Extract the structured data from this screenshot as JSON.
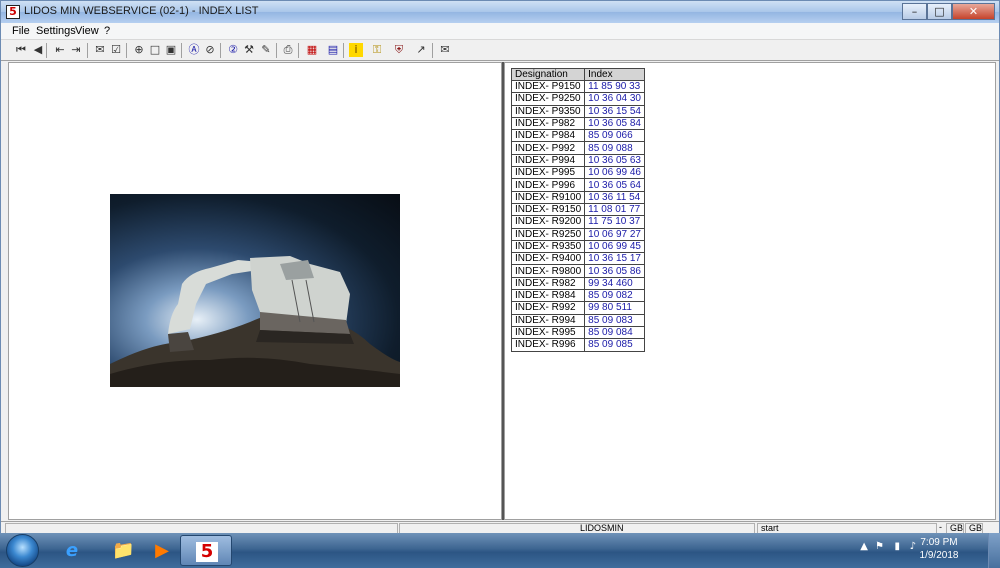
{
  "window": {
    "title": "LIDOS MIN WEBSERVICE (02-1) - INDEX LIST",
    "app_icon_text": "5",
    "minimize_glyph": "–",
    "maximize_glyph": "□",
    "close_glyph": "✕"
  },
  "menu": {
    "items": [
      "File",
      "Settings",
      "View",
      "?"
    ]
  },
  "toolbar": {
    "icons": [
      {
        "name": "first-page-icon",
        "glyph": "⏮"
      },
      {
        "name": "prev-page-icon",
        "glyph": "◀"
      },
      {
        "name": "back-icon",
        "glyph": "⇤"
      },
      {
        "name": "forward-icon",
        "glyph": "⇥"
      },
      {
        "name": "mail-icon",
        "glyph": "✉"
      },
      {
        "name": "checklist-icon",
        "glyph": "☑"
      },
      {
        "name": "zoom-icon",
        "glyph": "⊕"
      },
      {
        "name": "page-icon",
        "glyph": "□"
      },
      {
        "name": "page-fit-icon",
        "glyph": "▣"
      },
      {
        "name": "search-a-icon",
        "glyph": "Ⓐ"
      },
      {
        "name": "search-clear-icon",
        "glyph": "⊘"
      },
      {
        "name": "help-icon",
        "glyph": "②"
      },
      {
        "name": "tools-icon",
        "glyph": "⚒"
      },
      {
        "name": "edit-icon",
        "glyph": "✎"
      },
      {
        "name": "print-icon",
        "glyph": "⎙"
      },
      {
        "name": "grid-icon",
        "glyph": "▦"
      },
      {
        "name": "table-icon",
        "glyph": "▤"
      },
      {
        "name": "info-icon",
        "glyph": "i"
      },
      {
        "name": "key-icon",
        "glyph": "⚿"
      },
      {
        "name": "shield-icon",
        "glyph": "⛨"
      },
      {
        "name": "chart-icon",
        "glyph": "↗"
      },
      {
        "name": "message-icon",
        "glyph": "✉"
      }
    ]
  },
  "index_table": {
    "headers": [
      "Designation",
      "Index"
    ],
    "rows": [
      [
        "INDEX- P9150",
        "11 85 90 33"
      ],
      [
        "INDEX- P9250",
        "10 36 04 30"
      ],
      [
        "INDEX- P9350",
        "10 36 15 54"
      ],
      [
        "INDEX- P982",
        "10 36 05 84"
      ],
      [
        "INDEX- P984",
        "85 09 066"
      ],
      [
        "INDEX- P992",
        "85 09 088"
      ],
      [
        "INDEX- P994",
        "10 36 05 63"
      ],
      [
        "INDEX- P995",
        "10 06 99 46"
      ],
      [
        "INDEX- P996",
        "10 36 05 64"
      ],
      [
        "INDEX- R9100",
        "10 36 11 54"
      ],
      [
        "INDEX- R9150",
        "11 08 01 77"
      ],
      [
        "INDEX- R9200",
        "11 75 10 37"
      ],
      [
        "INDEX- R9250",
        "10 06 97 27"
      ],
      [
        "INDEX- R9350",
        "10 06 99 45"
      ],
      [
        "INDEX- R9400",
        "10 36 15 17"
      ],
      [
        "INDEX- R9800",
        "10 36 05 86"
      ],
      [
        "INDEX- R982",
        "99 34 460"
      ],
      [
        "INDEX- R984",
        "85 09 082"
      ],
      [
        "INDEX- R992",
        "99 80 511"
      ],
      [
        "INDEX- R994",
        "85 09 083"
      ],
      [
        "INDEX- R995",
        "85 09 084"
      ],
      [
        "INDEX- R996",
        "85 09 085"
      ]
    ]
  },
  "statusbar": {
    "server": "LIDOSMIN",
    "mode": "start",
    "lang_prefix": "-",
    "lang1": "GB",
    "lang2": "GB"
  },
  "taskbar": {
    "apps": [
      {
        "name": "taskbar-ie-icon",
        "glyph": "e"
      },
      {
        "name": "taskbar-explorer-icon",
        "glyph": "📁"
      },
      {
        "name": "taskbar-media-player-icon",
        "glyph": "▶"
      },
      {
        "name": "taskbar-lidos-icon",
        "glyph": "5"
      }
    ],
    "tray_glyphs": [
      "▲",
      "⚑",
      "▮",
      "♪"
    ],
    "time": "7:09 PM",
    "date": "1/9/2018"
  },
  "colors": {
    "index_link": "#1a1aa8",
    "title_bar": "#a9c6ea",
    "taskbar": "#2c5584"
  }
}
